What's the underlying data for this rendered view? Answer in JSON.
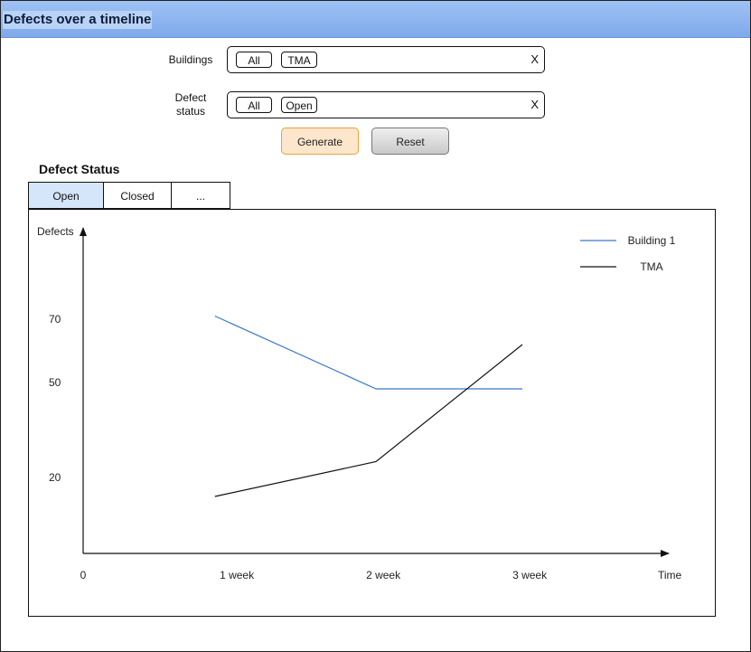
{
  "window": {
    "title": "Defects over a timeline"
  },
  "filters": {
    "buildings": {
      "label": "Buildings",
      "chips": [
        "All",
        "TMA"
      ],
      "clear": "X"
    },
    "defect_status": {
      "label_line1": "Defect",
      "label_line2": "status",
      "chips": [
        "All",
        "Open"
      ],
      "clear": "X"
    }
  },
  "actions": {
    "generate": "Generate",
    "reset": "Reset"
  },
  "section": {
    "title": "Defect Status"
  },
  "tabs": [
    {
      "label": "Open",
      "active": true
    },
    {
      "label": "Closed",
      "active": false
    },
    {
      "label": "...",
      "active": false
    }
  ],
  "chart_data": {
    "type": "line",
    "title": "",
    "xlabel": "Time",
    "ylabel": "Defects",
    "x_ticks": [
      "0",
      "1 week",
      "2 week",
      "3 week"
    ],
    "y_ticks": [
      20,
      50,
      70
    ],
    "legend_position": "top-right",
    "series": [
      {
        "name": "Building 1",
        "color": "#3a78c9",
        "points": [
          [
            0.9,
            71
          ],
          [
            2.0,
            48
          ],
          [
            3.0,
            48
          ]
        ]
      },
      {
        "name": "TMA",
        "color": "#111111",
        "points": [
          [
            0.9,
            14
          ],
          [
            2.0,
            25
          ],
          [
            3.0,
            62
          ]
        ]
      }
    ]
  }
}
